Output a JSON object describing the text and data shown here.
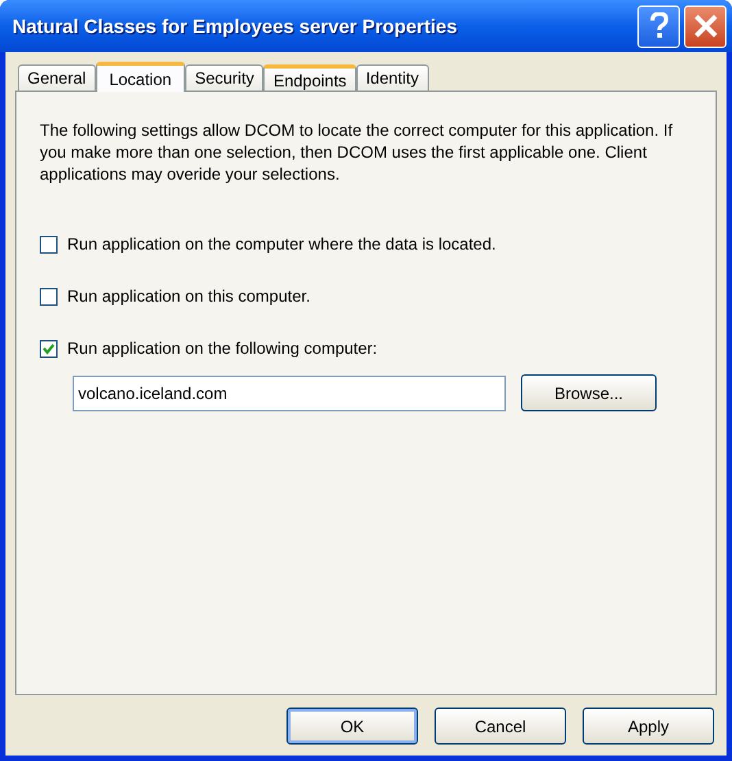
{
  "window": {
    "title": "Natural Classes for Employees server Properties"
  },
  "tabs": [
    {
      "label": "General",
      "selected": false,
      "hovered": false
    },
    {
      "label": "Location",
      "selected": true,
      "hovered": false
    },
    {
      "label": "Security",
      "selected": false,
      "hovered": false
    },
    {
      "label": "Endpoints",
      "selected": false,
      "hovered": true
    },
    {
      "label": "Identity",
      "selected": false,
      "hovered": false
    }
  ],
  "description": "The following settings allow DCOM to locate the correct computer for this application. If you make more than one selection, then DCOM uses the first applicable one. Client applications may overide your selections.",
  "options": [
    {
      "label": "Run application on the computer where the data is located.",
      "checked": false
    },
    {
      "label": "Run application on this computer.",
      "checked": false
    },
    {
      "label": "Run application on the following computer:",
      "checked": true
    }
  ],
  "computer_field": {
    "value": "volcano.iceland.com"
  },
  "browse_button": "Browse...",
  "buttons": [
    {
      "label": "OK",
      "default": true
    },
    {
      "label": "Cancel",
      "default": false
    },
    {
      "label": "Apply",
      "default": false
    }
  ]
}
